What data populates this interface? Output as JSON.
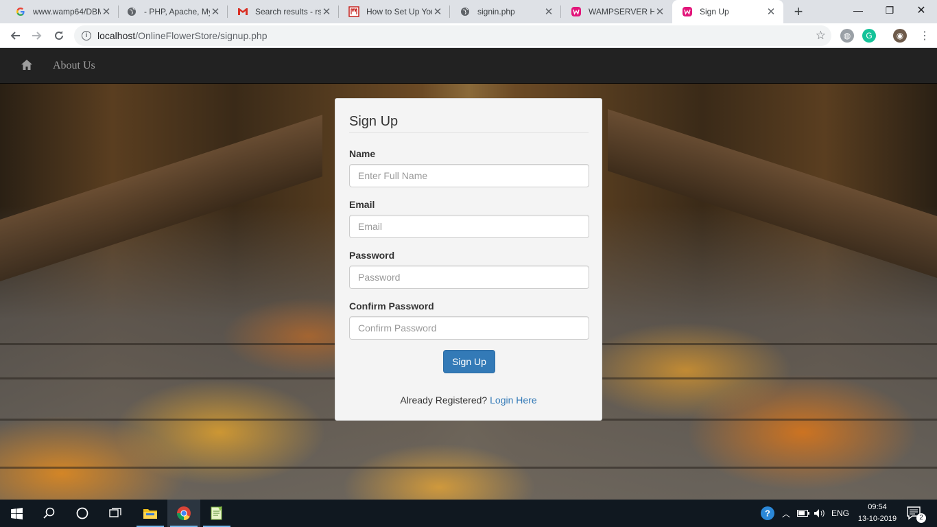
{
  "browser": {
    "tabs": [
      {
        "title": "www.wamp64/DBMS",
        "icon": "google-g-icon",
        "active": false
      },
      {
        "title": "- PHP, Apache, MySQL",
        "icon": "globe-icon",
        "active": false
      },
      {
        "title": "Search results - rsa",
        "icon": "gmail-icon",
        "active": false
      },
      {
        "title": "How to Set Up Your",
        "icon": "red-m-icon",
        "active": false
      },
      {
        "title": "signin.php",
        "icon": "globe-icon",
        "active": false
      },
      {
        "title": "WAMPSERVER Home",
        "icon": "wamp-icon",
        "active": false
      },
      {
        "title": "Sign Up",
        "icon": "wamp-icon",
        "active": true
      }
    ],
    "url_host": "localhost",
    "url_path": "/OnlineFlowerStore/signup.php"
  },
  "site_nav": {
    "home_icon": "home-icon",
    "about_label": "About Us"
  },
  "form": {
    "title": "Sign Up",
    "fields": [
      {
        "label": "Name",
        "placeholder": "Enter Full Name"
      },
      {
        "label": "Email",
        "placeholder": "Email"
      },
      {
        "label": "Password",
        "placeholder": "Password"
      },
      {
        "label": "Confirm Password",
        "placeholder": "Confirm Password"
      }
    ],
    "submit_label": "Sign Up",
    "already_text": "Already Registered?",
    "login_link": "Login Here"
  },
  "taskbar": {
    "language": "ENG",
    "time": "09:54",
    "date": "13-10-2019",
    "notification_count": "2"
  },
  "colors": {
    "primary": "#337ab7",
    "navbar": "#222222",
    "card": "#f4f4f4"
  }
}
